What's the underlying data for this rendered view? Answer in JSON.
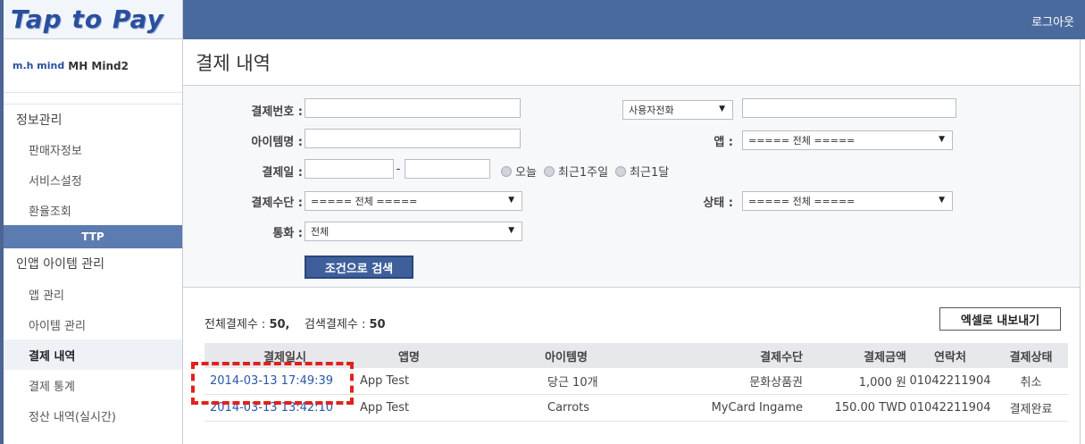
{
  "app": {
    "logo": "Tap to Pay",
    "logout_label": "로그아웃"
  },
  "brand": {
    "logo_text": "m.h mind",
    "name": "MH Mind2"
  },
  "sidebar": {
    "sections": [
      {
        "label": "정보관리",
        "items": [
          "판매자정보",
          "서비스설정",
          "환율조회"
        ]
      },
      {
        "label": "TTP"
      },
      {
        "label": "인앱 아이템 관리",
        "items": [
          "앱 관리",
          "아이템 관리",
          "결제 내역",
          "결제 통계",
          "정산 내역(실시간)"
        ]
      }
    ],
    "active_item": "결제 내역"
  },
  "page": {
    "title": "결제 내역"
  },
  "filters": {
    "payment_no_label": "결제번호 :",
    "phone_select": "사용자전화",
    "item_name_label": "아이템명 :",
    "app_label": "앱 :",
    "app_select": "===== 전체 =====",
    "pay_date_label": "결제일 :",
    "date_separator": "-",
    "radios": [
      "오늘",
      "최근1주일",
      "최근1달"
    ],
    "pay_method_label": "결제수단 :",
    "pay_method_select": "===== 전체 =====",
    "status_label": "상태 :",
    "status_select": "===== 전체 =====",
    "currency_label": "통화 :",
    "currency_select": "전체",
    "search_button": "조건으로 검색"
  },
  "summary": {
    "total_label": "전체결제수 :",
    "total_value": "50,",
    "search_label": "검색결제수 :",
    "search_value": "50"
  },
  "export_button": "엑셀로 내보내기",
  "table": {
    "columns": [
      "결제일시",
      "앱명",
      "아이템명",
      "결제수단",
      "결제금액",
      "연락처",
      "결제상태"
    ],
    "rows": [
      [
        "2014-03-13 17:49:39",
        "App Test",
        "당근 10개",
        "문화상품권",
        "1,000 원",
        "01042211904",
        "취소"
      ],
      [
        "2014-03-13 13:42:10",
        "App Test",
        "Carrots",
        "MyCard Ingame",
        "150.00 TWD",
        "01042211904",
        "결제완료"
      ]
    ]
  },
  "colors": {
    "topbar": "#4a6a9e",
    "button": "#3e5f9c",
    "highlight": "#e0211d",
    "link": "#2a57a8"
  }
}
